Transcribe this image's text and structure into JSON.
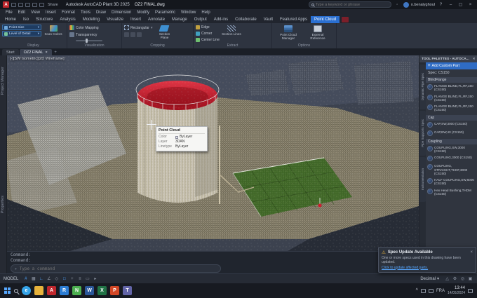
{
  "icons": {
    "caret_down": "▾",
    "caret_up": "^",
    "warning": "⚠",
    "plus": "+",
    "close": "×",
    "minimize": "–",
    "maximize": "▢",
    "help": "?",
    "prompt": "▸"
  },
  "title_bar": {
    "logo": "A",
    "share": "Share",
    "title": "Autodesk AutoCAD Plant 3D 2025",
    "doc": "OZ2 FINAL.dwg",
    "search_placeholder": "Type a keyword or phrase",
    "user": "o.benalyghoul"
  },
  "menu": {
    "items": [
      "File",
      "Edit",
      "View",
      "Insert",
      "Format",
      "Tools",
      "Draw",
      "Dimension",
      "Modify",
      "Parametric",
      "Window",
      "Help"
    ]
  },
  "ribbon": {
    "tabs": [
      "Home",
      "Iso",
      "Structure",
      "Analysis",
      "Modeling",
      "Visualize",
      "Insert",
      "Annotate",
      "Manage",
      "Output",
      "Add-ins",
      "Collaborate",
      "Vault",
      "Featured Apps",
      "Point Cloud"
    ],
    "display": {
      "label": "Display",
      "dropdown1": "Point Size",
      "dropdown2": "Level of Detail",
      "scan_colors": "Scan Colors"
    },
    "visualization": {
      "label": "Visualization",
      "color_mapping": "Color Mapping",
      "transparency": "Transparency"
    },
    "cropping": {
      "label": "Cropping",
      "rectangular": "Rectangular",
      "section_plane": "Section Plane"
    },
    "extract": {
      "label": "Extract",
      "edge": "Edge",
      "corner": "Corner",
      "center_line": "Center Line",
      "section_lines": "Section Lines"
    },
    "options": {
      "label": "Options",
      "manager": "Point Cloud Manager",
      "external": "External Reference"
    }
  },
  "doc_tabs": {
    "start": "Start",
    "active": "OZ2 FINAL"
  },
  "left_tabs": {
    "project_manager": "Project Manager",
    "properties": "Properties"
  },
  "viewport": {
    "controls": "[-][SW Isometric][2D Wireframe]"
  },
  "tooltip": {
    "title": "Point Cloud",
    "rows": [
      {
        "k": "Color",
        "v": "ByLayer"
      },
      {
        "k": "Layer",
        "v": "3DAN"
      },
      {
        "k": "Linetype",
        "v": "ByLayer"
      }
    ]
  },
  "palette": {
    "header": "TOOL PALETTES - AUTOCA...",
    "add_button": "Add Custom Part",
    "spec": "Spec: CS150",
    "groups": [
      {
        "name": "BlindFlange",
        "items": [
          "FLANGE BLIND,FL,RF,150 (CS150)",
          "FLANGE BLIND,FL,RF,150 (CS150)",
          "FLANGE BLIND,FL,RF,150 (CS150)"
        ]
      },
      {
        "name": "Cap",
        "items": [
          "CAP,SW,3000 (CS150)",
          "CAP,BW,40 (CS150)"
        ]
      },
      {
        "name": "Coupling",
        "items": [
          "COUPLING,SW,3000 (CS150)",
          "COUPLING,3000 (CS150)",
          "COUPLING, STRAIGHT,THDF,3000 (CS150)",
          "HALF COUPLING,SW,6000 (CS150)",
          "Hex Head Bushing,THDM (CS150)"
        ]
      }
    ],
    "side_tabs": [
      "Dynamic Pipe Spec",
      "Pipe Supports Spec",
      "Instrumentation"
    ]
  },
  "command": {
    "line1": "Command:",
    "line2": "Command:",
    "prompt_placeholder": "Type a command"
  },
  "toast": {
    "title": "Spec Update Available",
    "body": "One or more specs used in this drawing have been updated.",
    "link": "Click to update affected parts."
  },
  "status_bar": {
    "model": "MODEL",
    "units": "Decimal",
    "icons": [
      {
        "name": "grid",
        "glyph": "#"
      },
      {
        "name": "snap",
        "glyph": "▦"
      },
      {
        "name": "ortho",
        "glyph": "∟"
      },
      {
        "name": "polar",
        "glyph": "∠"
      },
      {
        "name": "isodraft",
        "glyph": "◇"
      },
      {
        "name": "osnap",
        "glyph": "□"
      },
      {
        "name": "otrack",
        "glyph": "+"
      },
      {
        "name": "lineweight",
        "glyph": "≡"
      },
      {
        "name": "transparency",
        "glyph": "▭"
      },
      {
        "name": "selection-cycling",
        "glyph": "▸"
      }
    ],
    "right_icons": [
      {
        "name": "annotation-scale",
        "glyph": "△"
      },
      {
        "name": "workspace-gear",
        "glyph": "⚙"
      },
      {
        "name": "isolate-objects",
        "glyph": "◎"
      },
      {
        "name": "clean-screen",
        "glyph": "▣"
      }
    ]
  },
  "taskbar": {
    "lang": "FRA",
    "time": "13:44",
    "date": "14/05/2024",
    "apps": [
      {
        "name": "edge",
        "letter": "e",
        "color": "#35a3e8"
      },
      {
        "name": "file-explorer",
        "letter": "",
        "color": "#e8b33c"
      },
      {
        "name": "autocad",
        "letter": "A",
        "color": "#c0272d"
      },
      {
        "name": "recap",
        "letter": "R",
        "color": "#2b7cd3"
      },
      {
        "name": "navisworks",
        "letter": "N",
        "color": "#4caf50"
      },
      {
        "name": "word",
        "letter": "W",
        "color": "#2b579a"
      },
      {
        "name": "excel",
        "letter": "X",
        "color": "#217346"
      },
      {
        "name": "powerpoint",
        "letter": "P",
        "color": "#d24726"
      },
      {
        "name": "teams",
        "letter": "T",
        "color": "#6264a7"
      }
    ]
  }
}
